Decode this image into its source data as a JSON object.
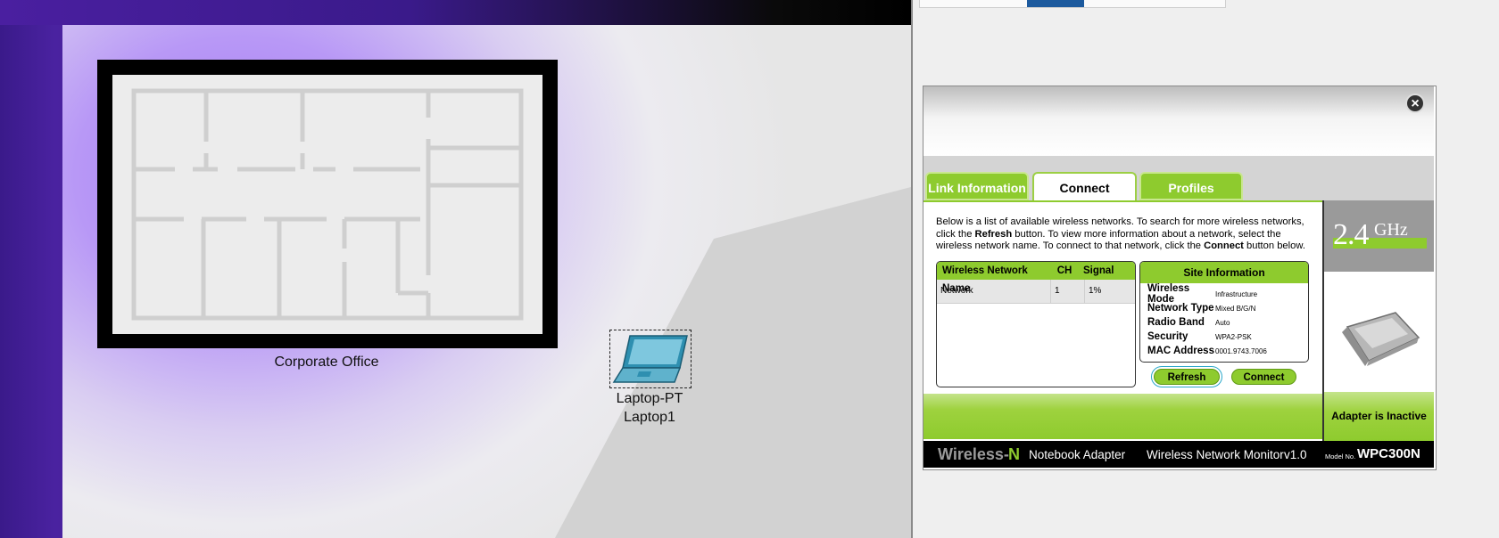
{
  "workspace": {
    "office_label": "Corporate Office",
    "device_type": "Laptop-PT",
    "device_name": "Laptop1"
  },
  "monitor": {
    "tabs": [
      {
        "label": "Link Information",
        "active": false
      },
      {
        "label": "Connect",
        "active": true
      },
      {
        "label": "Profiles",
        "active": false
      }
    ],
    "description": {
      "part1": "Below is a list of available wireless networks. To search for more wireless networks, click the ",
      "bold1": "Refresh",
      "part2": " button. To view more information about a network, select the wireless network name. To connect to that network, click the ",
      "bold2": "Connect",
      "part3": " button below."
    },
    "network_table": {
      "headers": [
        "Wireless Network Name",
        "CH",
        "Signal"
      ],
      "rows": [
        {
          "name": "Network",
          "ch": "1",
          "signal": "1%"
        }
      ]
    },
    "site_information": {
      "title": "Site Information",
      "rows": [
        {
          "label": "Wireless Mode",
          "value": "Infrastructure"
        },
        {
          "label": "Network Type",
          "value": "Mixed B/G/N"
        },
        {
          "label": "Radio Band",
          "value": "Auto"
        },
        {
          "label": "Security",
          "value": "WPA2-PSK"
        },
        {
          "label": "MAC Address",
          "value": "0001.9743.7006"
        }
      ]
    },
    "buttons": {
      "refresh": "Refresh",
      "connect": "Connect"
    },
    "band": {
      "number": "2.4",
      "unit": "GHz"
    },
    "status": "Adapter is Inactive",
    "footer": {
      "brand_wireless": "Wireless-",
      "brand_n": "N",
      "product": "Notebook Adapter",
      "monitor": "Wireless Network Monitor",
      "version": "v1.0",
      "model_label": "Model No.",
      "model": "WPC300N"
    },
    "colors": {
      "accent_green": "#8ecb2e",
      "footer_black": "#000000"
    }
  }
}
